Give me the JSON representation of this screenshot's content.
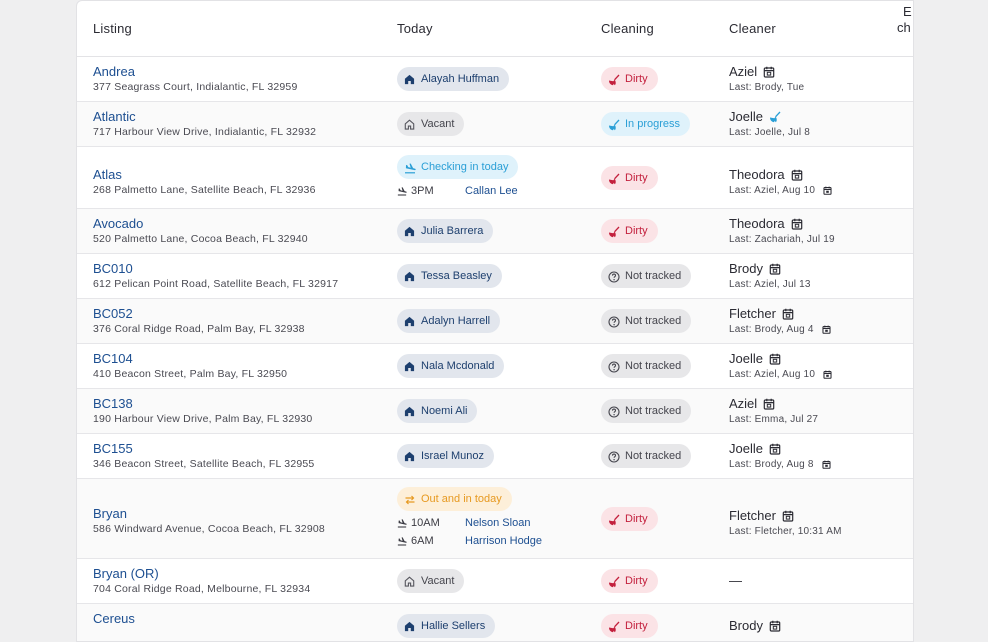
{
  "headers": {
    "listing": "Listing",
    "today": "Today",
    "cleaning": "Cleaning",
    "cleaner": "Cleaner",
    "extra_line1": "E",
    "extra_line2": "ch"
  },
  "colors": {
    "link": "#1d4f91",
    "dirty": "#c3203d",
    "progress": "#2a9fd6",
    "out": "#e79a22"
  },
  "rows": [
    {
      "name": "Andrea",
      "address": "377 Seagrass Court, Indialantic, FL 32959",
      "today": {
        "type": "guest",
        "label": "Alayah Huffman",
        "icon": "home-icon"
      },
      "cleaning": {
        "type": "dirty",
        "label": "Dirty",
        "icon": "broom-icon"
      },
      "cleaner": "Aziel",
      "cleaner_icon": "calendar-icon",
      "last": "Last: Brody, Tue"
    },
    {
      "name": "Atlantic",
      "address": "717 Harbour View Drive, Indialantic, FL 32932",
      "today": {
        "type": "vacant",
        "label": "Vacant",
        "icon": "home-outline-icon"
      },
      "cleaning": {
        "type": "progress",
        "label": "In progress",
        "icon": "broom-icon"
      },
      "cleaner": "Joelle",
      "cleaner_icon": "broom-icon",
      "last": "Last: Joelle, Jul 8"
    },
    {
      "name": "Atlas",
      "address": "268 Palmetto Lane, Satellite Beach, FL 32936",
      "today": {
        "type": "check",
        "label": "Checking in today",
        "icon": "plane-arrive-icon"
      },
      "arrivals": [
        {
          "time": "3PM",
          "guest": "Callan Lee"
        }
      ],
      "cleaning": {
        "type": "dirty",
        "label": "Dirty",
        "icon": "broom-icon"
      },
      "cleaner": "Theodora",
      "cleaner_icon": "calendar-icon",
      "last": "Last: Aziel, Aug 10",
      "last_icon": true
    },
    {
      "name": "Avocado",
      "address": "520 Palmetto Lane, Cocoa Beach, FL 32940",
      "today": {
        "type": "guest",
        "label": "Julia Barrera",
        "icon": "home-icon"
      },
      "cleaning": {
        "type": "dirty",
        "label": "Dirty",
        "icon": "broom-icon"
      },
      "cleaner": "Theodora",
      "cleaner_icon": "calendar-icon",
      "last": "Last: Zachariah, Jul 19"
    },
    {
      "name": "BC010",
      "address": "612 Pelican Point Road, Satellite Beach, FL 32917",
      "today": {
        "type": "guest",
        "label": "Tessa Beasley",
        "icon": "home-icon"
      },
      "cleaning": {
        "type": "nt",
        "label": "Not tracked",
        "icon": "question-icon"
      },
      "cleaner": "Brody",
      "cleaner_icon": "calendar-icon",
      "last": "Last: Aziel, Jul 13"
    },
    {
      "name": "BC052",
      "address": "376 Coral Ridge Road, Palm Bay, FL 32938",
      "today": {
        "type": "guest",
        "label": "Adalyn Harrell",
        "icon": "home-icon"
      },
      "cleaning": {
        "type": "nt",
        "label": "Not tracked",
        "icon": "question-icon"
      },
      "cleaner": "Fletcher",
      "cleaner_icon": "calendar-icon",
      "last": "Last: Brody, Aug 4",
      "last_icon": true
    },
    {
      "name": "BC104",
      "address": "410 Beacon Street, Palm Bay, FL 32950",
      "today": {
        "type": "guest",
        "label": "Nala Mcdonald",
        "icon": "home-icon"
      },
      "cleaning": {
        "type": "nt",
        "label": "Not tracked",
        "icon": "question-icon"
      },
      "cleaner": "Joelle",
      "cleaner_icon": "calendar-icon",
      "last": "Last: Aziel, Aug 10",
      "last_icon": true
    },
    {
      "name": "BC138",
      "address": "190 Harbour View Drive, Palm Bay, FL 32930",
      "today": {
        "type": "guest",
        "label": "Noemi Ali",
        "icon": "home-icon"
      },
      "cleaning": {
        "type": "nt",
        "label": "Not tracked",
        "icon": "question-icon"
      },
      "cleaner": "Aziel",
      "cleaner_icon": "calendar-icon",
      "last": "Last: Emma, Jul 27"
    },
    {
      "name": "BC155",
      "address": "346 Beacon Street, Satellite Beach, FL 32955",
      "today": {
        "type": "guest",
        "label": "Israel Munoz",
        "icon": "home-icon"
      },
      "cleaning": {
        "type": "nt",
        "label": "Not tracked",
        "icon": "question-icon"
      },
      "cleaner": "Joelle",
      "cleaner_icon": "calendar-icon",
      "last": "Last: Brody, Aug 8",
      "last_icon": true
    },
    {
      "name": "Bryan",
      "address": "586 Windward Avenue, Cocoa Beach, FL 32908",
      "today": {
        "type": "out",
        "label": "Out and in today",
        "icon": "swap-icon"
      },
      "arrivals": [
        {
          "time": "10AM",
          "guest": "Nelson Sloan"
        },
        {
          "time": "6AM",
          "guest": "Harrison Hodge"
        }
      ],
      "cleaning": {
        "type": "dirty",
        "label": "Dirty",
        "icon": "broom-icon"
      },
      "cleaner": "Fletcher",
      "cleaner_icon": "calendar-icon",
      "last": "Last: Fletcher, 10:31 AM"
    },
    {
      "name": "Bryan (OR)",
      "address": "704 Coral Ridge Road, Melbourne, FL 32934",
      "today": {
        "type": "vacant",
        "label": "Vacant",
        "icon": "home-outline-icon"
      },
      "cleaning": {
        "type": "dirty",
        "label": "Dirty",
        "icon": "broom-icon"
      },
      "cleaner": "—",
      "cleaner_icon": "",
      "last": ""
    },
    {
      "name": "Cereus",
      "address": "",
      "today": {
        "type": "guest",
        "label": "Hallie Sellers",
        "icon": "home-icon"
      },
      "cleaning": {
        "type": "dirty",
        "label": "Dirty",
        "icon": "broom-icon"
      },
      "cleaner": "Brody",
      "cleaner_icon": "calendar-icon",
      "last": ""
    }
  ]
}
